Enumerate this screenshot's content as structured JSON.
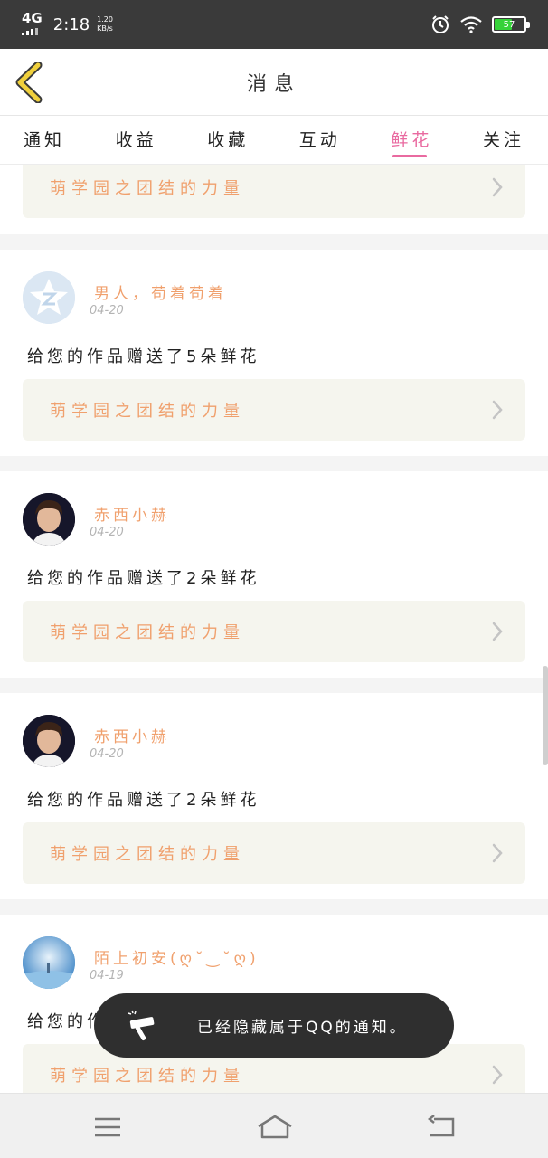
{
  "status_bar": {
    "network": "4G",
    "time": "2:18",
    "speed_value": "1.20",
    "speed_unit": "KB/s",
    "battery": "57"
  },
  "header": {
    "title": "消息",
    "back_icon": "chevron-left-icon"
  },
  "tabs": [
    {
      "label": "通知",
      "active": false
    },
    {
      "label": "收益",
      "active": false
    },
    {
      "label": "收藏",
      "active": false
    },
    {
      "label": "互动",
      "active": false
    },
    {
      "label": "鲜花",
      "active": true
    },
    {
      "label": "关注",
      "active": false
    }
  ],
  "top_partial": {
    "link_text": "萌学园之团结的力量"
  },
  "items": [
    {
      "user": "男人，苟着苟着",
      "date": "04-20",
      "message": "给您的作品赠送了5朵鲜花",
      "link_text": "萌学园之团结的力量"
    },
    {
      "user": "赤西小赫",
      "date": "04-20",
      "message": "给您的作品赠送了2朵鲜花",
      "link_text": "萌学园之团结的力量"
    },
    {
      "user": "赤西小赫",
      "date": "04-20",
      "message": "给您的作品赠送了2朵鲜花",
      "link_text": "萌学园之团结的力量"
    },
    {
      "user": "陌上初安(ღ˘‿˘ღ)",
      "date": "04-19",
      "message": "给您的作",
      "link_text": "萌学园之团结的力量"
    }
  ],
  "toast": {
    "text": "已经隐藏属于QQ的通知。"
  },
  "colors": {
    "accent_pink": "#e96aa0",
    "link_orange": "#f0a06d",
    "back_arrow": "#f0d03c"
  }
}
